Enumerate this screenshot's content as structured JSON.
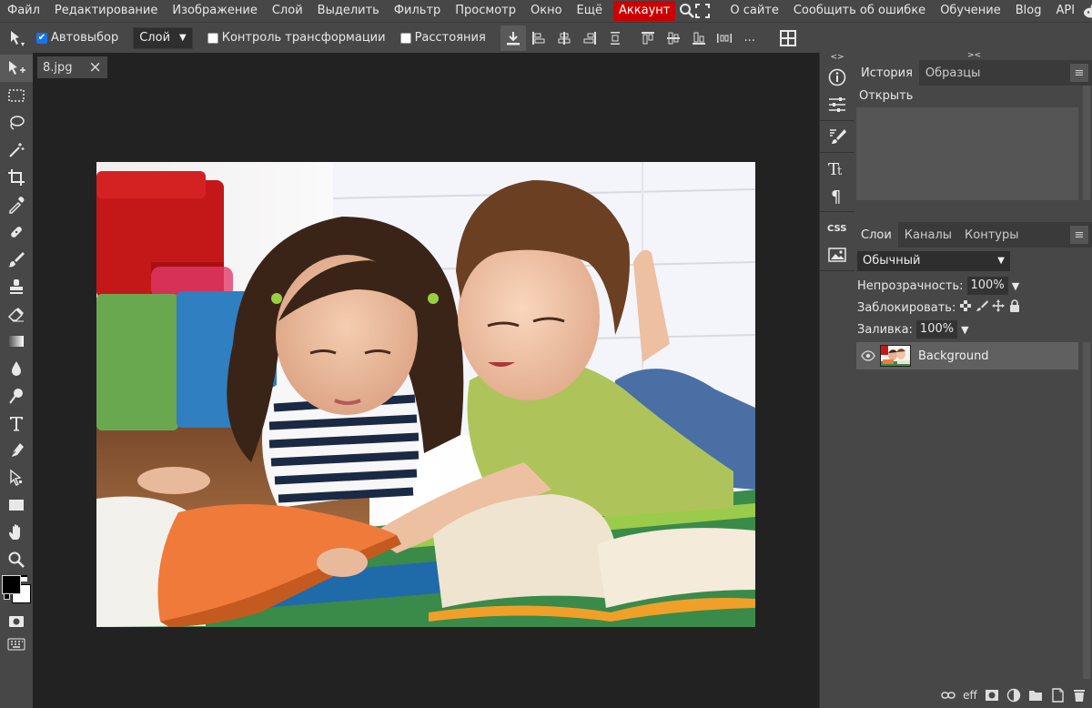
{
  "menu": {
    "items": [
      "Файл",
      "Редактирование",
      "Изображение",
      "Слой",
      "Выделить",
      "Фильтр",
      "Просмотр",
      "Окно",
      "Ещё"
    ],
    "account": "Аккаунт",
    "links": [
      "О сайте",
      "Сообщить об ошибке",
      "Обучение",
      "Blog",
      "API"
    ],
    "social_icons": [
      "reddit-icon",
      "twitter-icon",
      "facebook-icon"
    ]
  },
  "options": {
    "autoselect_label": "Автовыбор",
    "autoselect_checked": true,
    "target_value": "Слой",
    "transform_label": "Контроль трансформации",
    "transform_checked": false,
    "distances_label": "Расстояния",
    "distances_checked": false,
    "more_label": "..."
  },
  "document": {
    "tab_name": "8.jpg",
    "close_glyph": "×"
  },
  "history_panel": {
    "tabs": [
      "История",
      "Образцы"
    ],
    "items": [
      "Открыть"
    ]
  },
  "layers_panel": {
    "tabs": [
      "Слои",
      "Каналы",
      "Контуры"
    ],
    "blend_mode": "Обычный",
    "opacity_label": "Непрозрачность:",
    "opacity_value": "100%",
    "lock_label": "Заблокировать:",
    "fill_label": "Заливка:",
    "fill_value": "100%",
    "layers": [
      {
        "name": "Background",
        "visible": true
      }
    ]
  },
  "footer_labels": {
    "effects": "eff"
  },
  "panel_icons": [
    "info-icon",
    "adjustments-icon",
    "brush-settings-icon",
    "character-icon",
    "paragraph-icon",
    "css-icon",
    "image-icon"
  ],
  "colors": {
    "account_bg": "#cc0000",
    "accent": "#1a73e8"
  }
}
